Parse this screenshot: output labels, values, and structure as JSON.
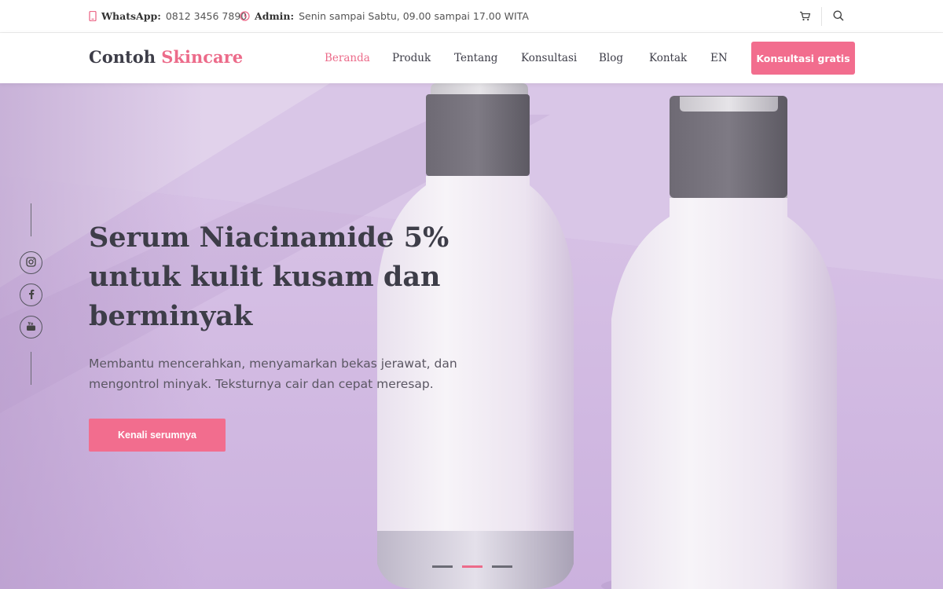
{
  "topbar": {
    "whatsapp_label": "WhatsApp:",
    "whatsapp_value": "0812 3456 7890",
    "admin_label": "Admin:",
    "admin_value": "Senin sampai Sabtu, 09.00 sampai 17.00 WITA",
    "icons": [
      "phone-icon",
      "clock-icon",
      "cart-icon",
      "search-icon"
    ]
  },
  "header": {
    "logo_main": "Contoh",
    "logo_accent": "Skincare",
    "nav": [
      "Beranda",
      "Produk",
      "Tentang",
      "Konsultasi",
      "Blog",
      "Kontak",
      "EN"
    ],
    "active_nav": "Beranda",
    "cta_label": "Konsultasi gratis"
  },
  "hero": {
    "title": "Serum Niacinamide 5% untuk kulit kusam dan berminyak",
    "description": "Membantu mencerahkan, menyamarkan bekas jerawat, dan mengontrol minyak. Teksturnya cair dan cepat meresap.",
    "button_label": "Kenali serumnya",
    "slides_total": 3,
    "slide_active": 2
  },
  "social": [
    "instagram-icon",
    "facebook-icon",
    "youtube-icon"
  ],
  "colors": {
    "accent": "#ec6b8a",
    "button": "#f26d8e",
    "text_dark": "#3d3d48",
    "hero_bg": "#d3bde3"
  }
}
